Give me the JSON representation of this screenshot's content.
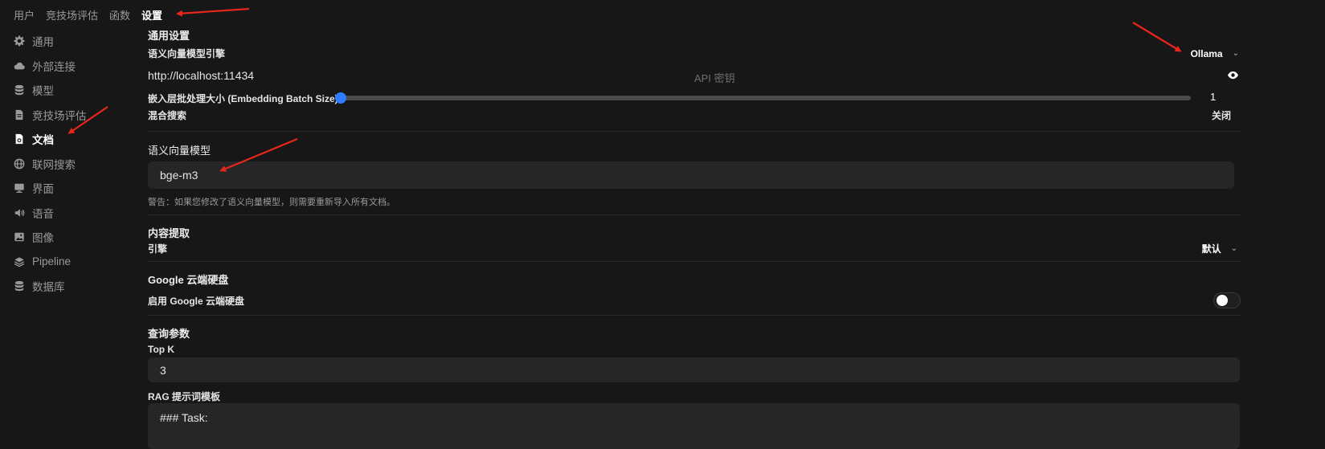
{
  "topnav": {
    "users": "用户",
    "arena": "竞技场评估",
    "functions": "函数",
    "settings": "设置"
  },
  "sidebar": {
    "items": [
      {
        "label": "通用",
        "icon": "gear-icon"
      },
      {
        "label": "外部连接",
        "icon": "cloud-icon"
      },
      {
        "label": "模型",
        "icon": "database-icon"
      },
      {
        "label": "竞技场评估",
        "icon": "document-icon"
      },
      {
        "label": "文档",
        "icon": "document-lock-icon"
      },
      {
        "label": "联网搜索",
        "icon": "globe-icon"
      },
      {
        "label": "界面",
        "icon": "monitor-icon"
      },
      {
        "label": "语音",
        "icon": "speaker-icon"
      },
      {
        "label": "图像",
        "icon": "image-icon"
      },
      {
        "label": "Pipeline",
        "icon": "layers-icon"
      },
      {
        "label": "数据库",
        "icon": "database-icon"
      }
    ]
  },
  "general": {
    "title": "通用设置",
    "engine_label": "语义向量模型引擎",
    "engine_value": "Ollama",
    "url_value": "http://localhost:11434",
    "api_key_placeholder": "API 密钥",
    "batch_label": "嵌入层批处理大小 (Embedding Batch Size)",
    "batch_value": "1",
    "batch_fraction": 0,
    "hybrid_label": "混合搜索",
    "hybrid_value": "关闭"
  },
  "embedding": {
    "title": "语义向量模型",
    "model_value": "bge-m3",
    "warning": "警告：如果您修改了语义向量模型，则需要重新导入所有文档。"
  },
  "content": {
    "title": "内容提取",
    "engine_label": "引擎",
    "engine_value": "默认"
  },
  "gdrive": {
    "title": "Google 云端硬盘",
    "enable_label": "启用 Google 云端硬盘",
    "enabled": false
  },
  "query": {
    "title": "查询参数",
    "topk_label": "Top K",
    "topk_value": "3",
    "rag_label": "RAG 提示词模板",
    "rag_value": "### Task:"
  },
  "colors": {
    "accent": "#2e7bff",
    "annotation": "#e8261c",
    "background": "#171717"
  }
}
